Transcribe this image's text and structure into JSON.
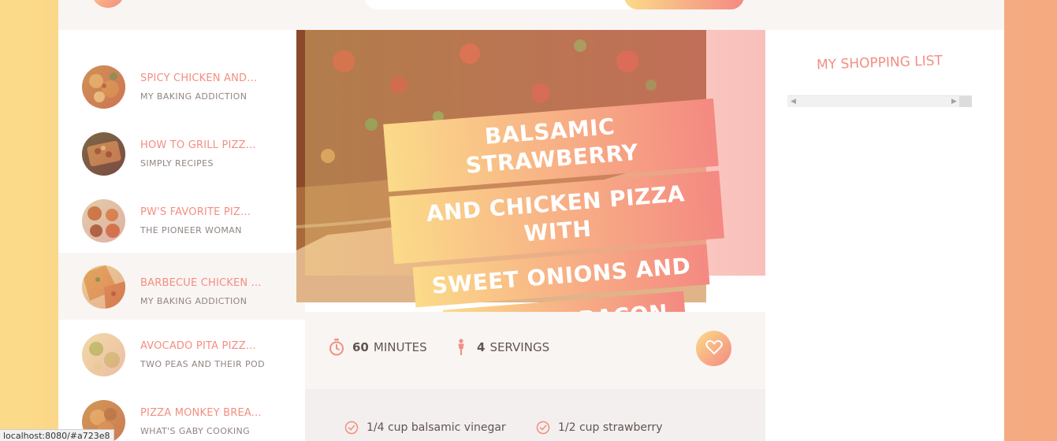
{
  "colors": {
    "accent": "#f38e82",
    "gradient_start": "#fbdb89",
    "gradient_end": "#f48982",
    "text": "#615551",
    "muted": "#918581",
    "panel": "#f9f5f3"
  },
  "results": [
    {
      "title": "SPICY CHICKEN AND...",
      "publisher": "MY BAKING ADDICTION",
      "active": false
    },
    {
      "title": "HOW TO GRILL PIZZ...",
      "publisher": "SIMPLY RECIPES",
      "active": false
    },
    {
      "title": "PW'S FAVORITE PIZ...",
      "publisher": "THE PIONEER WOMAN",
      "active": false
    },
    {
      "title": "BARBECUE CHICKEN ...",
      "publisher": "MY BAKING ADDICTION",
      "active": true
    },
    {
      "title": "AVOCADO PITA PIZZ...",
      "publisher": "TWO PEAS AND THEIR POD",
      "active": false
    },
    {
      "title": "PIZZA MONKEY BREA...",
      "publisher": "WHAT'S GABY COOKING",
      "active": false
    }
  ],
  "recipe": {
    "title_lines": [
      "BALSAMIC STRAWBERRY",
      "AND CHICKEN PIZZA WITH",
      "SWEET ONIONS AND",
      "SMOKED BACON"
    ],
    "time_value": "60",
    "time_unit": "MINUTES",
    "servings_value": "4",
    "servings_unit": "SERVINGS",
    "time_icon": "stopwatch-icon",
    "servings_icon": "person-icon",
    "favorite_icon": "heart-icon"
  },
  "ingredients": [
    {
      "text": "1/4 cup balsamic vinegar"
    },
    {
      "text": "1/2 cup strawberry"
    }
  ],
  "shopping": {
    "heading": "MY SHOPPING LIST"
  },
  "status_bar": "localhost:8080/#a723e8"
}
